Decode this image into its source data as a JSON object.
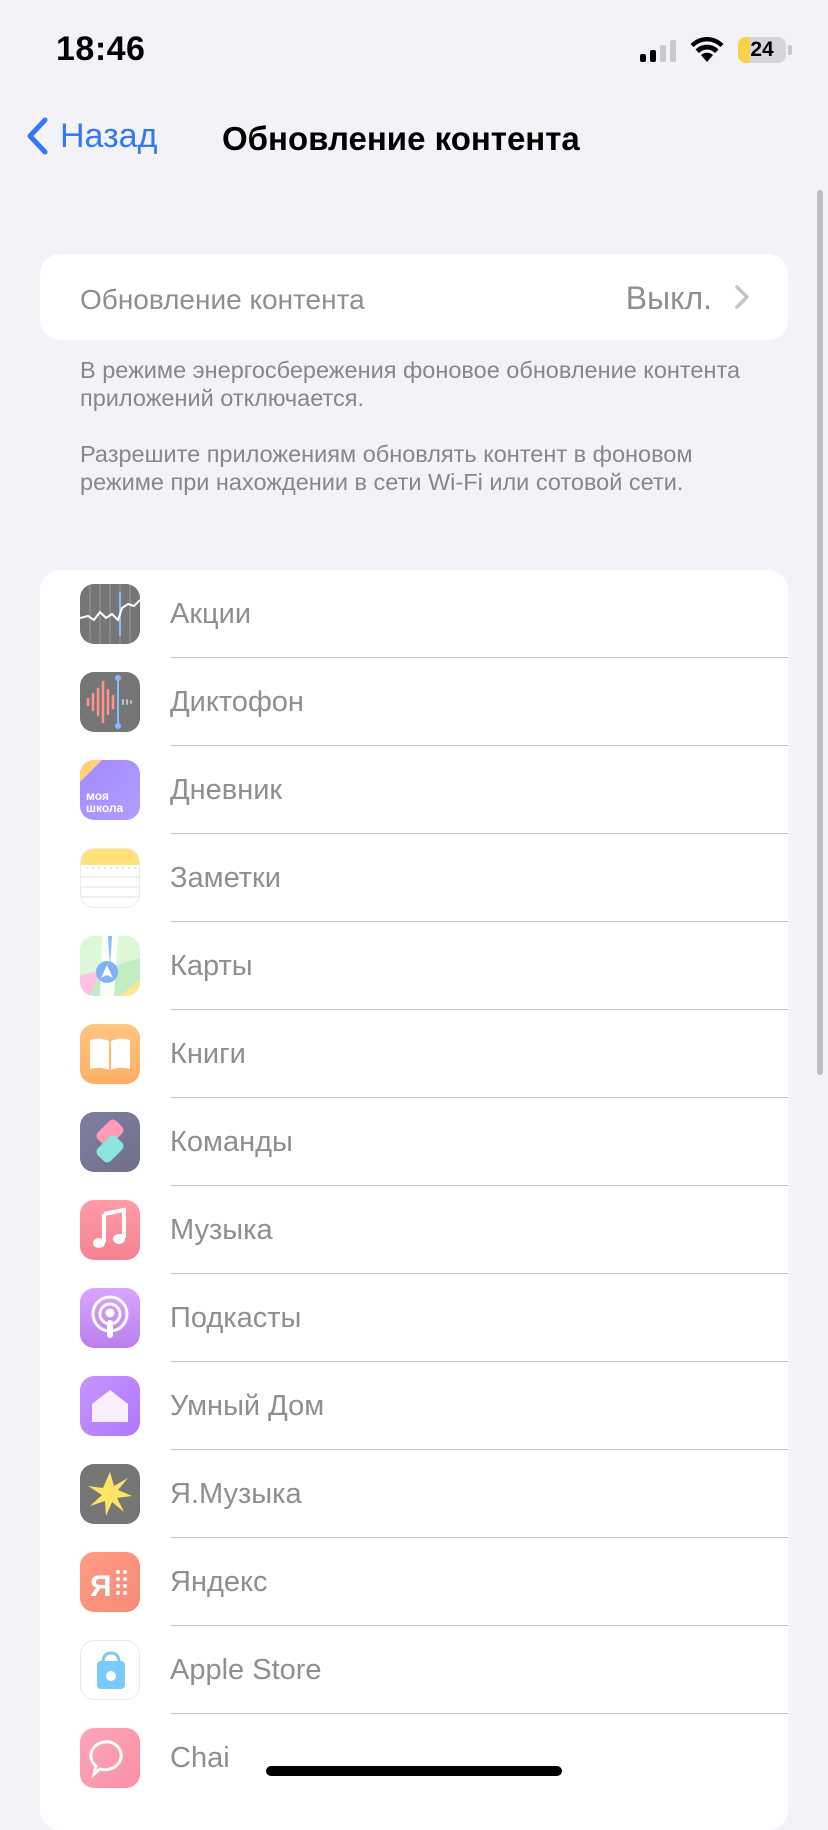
{
  "status": {
    "time": "18:46",
    "battery": "24",
    "battery_level": 0.24
  },
  "nav": {
    "back_label": "Назад",
    "title": "Обновление контента"
  },
  "setting": {
    "label": "Обновление контента",
    "value": "Выкл."
  },
  "footnotes": [
    "В режиме энергосбережения фоновое обновление контента приложений отключается.",
    "Разрешите приложениям обновлять контент в фоновом режиме при нахождении в сети Wi-Fi или сотовой сети."
  ],
  "apps": [
    {
      "name": "Акции",
      "icon": "stocks-icon"
    },
    {
      "name": "Диктофон",
      "icon": "voice-memos-icon"
    },
    {
      "name": "Дневник",
      "icon": "moya-shkola-icon",
      "icon_text": "моя\nшкола"
    },
    {
      "name": "Заметки",
      "icon": "notes-icon"
    },
    {
      "name": "Карты",
      "icon": "maps-icon"
    },
    {
      "name": "Книги",
      "icon": "books-icon"
    },
    {
      "name": "Команды",
      "icon": "shortcuts-icon"
    },
    {
      "name": "Музыка",
      "icon": "music-icon"
    },
    {
      "name": "Подкасты",
      "icon": "podcasts-icon"
    },
    {
      "name": "Умный Дом",
      "icon": "smart-home-icon"
    },
    {
      "name": "Я.Музыка",
      "icon": "yandex-music-icon"
    },
    {
      "name": "Яндекс",
      "icon": "yandex-icon"
    },
    {
      "name": "Apple Store",
      "icon": "apple-store-icon"
    },
    {
      "name": "Chai",
      "icon": "chai-icon"
    }
  ]
}
